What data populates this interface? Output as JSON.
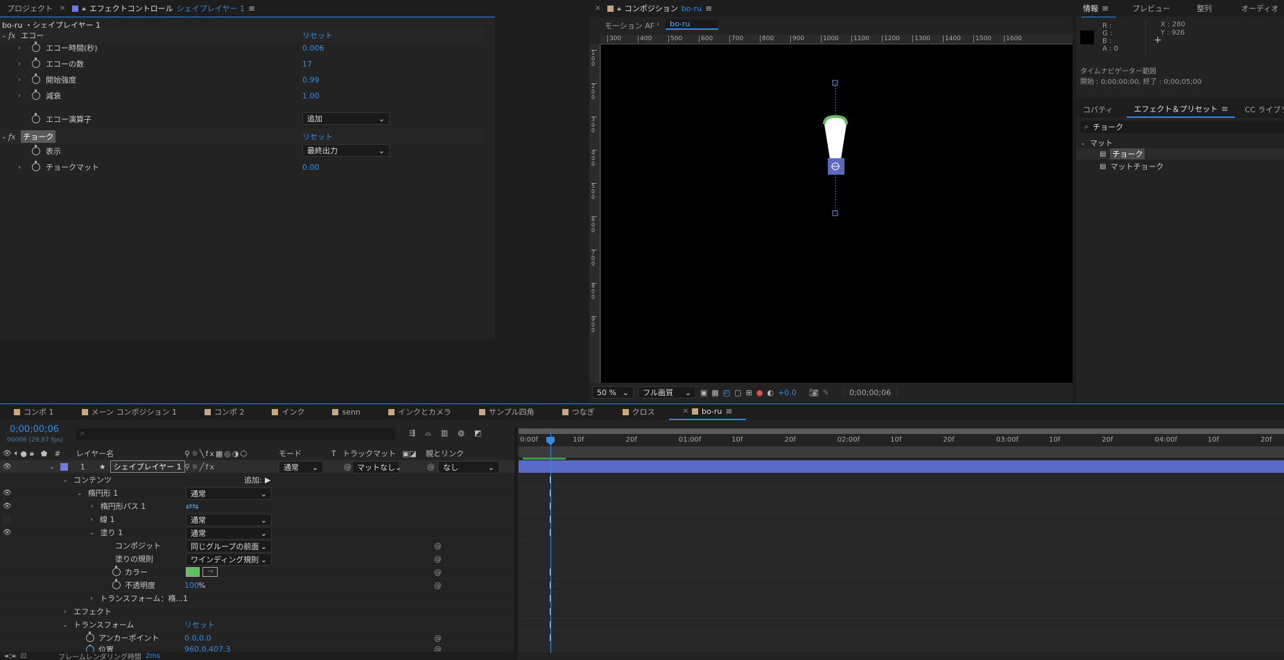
{
  "effect_panel": {
    "tab_project": "プロジェクト",
    "tab_effect_prefix": "エフェクトコントロール",
    "tab_effect_layer": "シェイプレイヤー 1",
    "breadcrumb": "bo-ru ・シェイプレイヤー 1",
    "echo": {
      "name": "エコー",
      "reset": "リセット",
      "params": [
        {
          "label": "エコー時間(秒)",
          "value": "0.006"
        },
        {
          "label": "エコーの数",
          "value": "17"
        },
        {
          "label": "開始強度",
          "value": "0.99"
        },
        {
          "label": "減衰",
          "value": "1.00"
        }
      ],
      "operator_label": "エコー演算子",
      "operator_value": "追加"
    },
    "choke": {
      "name": "チョーク",
      "reset": "リセット",
      "display_label": "表示",
      "display_value": "最終出力",
      "matte_label": "チョークマット",
      "matte_value": "0.00"
    }
  },
  "comp_panel": {
    "tab_prefix": "コンポジション",
    "tab_name": "bo-ru",
    "motion_label": "モーション AF",
    "crumb": "bo-ru",
    "ruler_h": [
      "300",
      "400",
      "500",
      "600",
      "700",
      "800",
      "900",
      "1000",
      "1100",
      "1200",
      "1300",
      "1400",
      "1500",
      "1600"
    ],
    "ruler_v": [
      "1 0 0",
      "2 0 0",
      "3 0 0",
      "4 0 0",
      "5 0 0",
      "6 0 0",
      "7 0 0",
      "8 0 0",
      "9 0 0"
    ],
    "zoom": "50 %",
    "quality": "フル画質",
    "exposure": "+0.0",
    "timecode": "0;00;00;06"
  },
  "info_panel": {
    "tabs": [
      "情報",
      "プレビュー",
      "整列",
      "オーディオ"
    ],
    "r": "R :",
    "g": "G :",
    "b": "B :",
    "a": "A : 0",
    "x": "X : 280",
    "y": "Y : 926",
    "nav_title": "タイムナビゲーター範囲",
    "nav_range": "開始 : 0;00;00;00, 終了 : 0;00;05;00"
  },
  "presets_panel": {
    "tabs": [
      "コパティ",
      "エフェクト＆プリセット",
      "CC ライブラリ"
    ],
    "search": "チョーク",
    "category": "マット",
    "items": [
      "チョーク",
      "マットチョーク"
    ]
  },
  "timeline": {
    "tabs": [
      "コンポ 1",
      "メーン コンポジション 1",
      "コンポ 2",
      "インク",
      "senn",
      "インクとカメラ",
      "サンプル四角",
      "つなぎ",
      "クロス",
      "bo-ru"
    ],
    "tab_colors": [
      "#c8a882",
      "#c8a882",
      "#c8a882",
      "#c8a882",
      "#c8a882",
      "#c8a882",
      "#c8a882",
      "#c8a882",
      "#c8a882",
      "#c8a882"
    ],
    "timecode": "0;00;00;06",
    "fps": "00006 (29.97 fps)",
    "search_placeholder": "",
    "headers": {
      "num": "#",
      "layer": "レイヤー名",
      "mode": "モード",
      "t": "T",
      "trackmatte": "トラックマット",
      "parent": "親とリンク"
    },
    "layer": {
      "num": "1",
      "name": "シェイプレイヤー 1",
      "mode": "通常",
      "matte": "マットなし",
      "parent": "なし"
    },
    "contents": "コンテンツ",
    "add": "追加:",
    "ellipse": "楕円形 1",
    "ellipse_mode": "通常",
    "ellipse_path": "楕円形パス 1",
    "stroke": "線 1",
    "stroke_mode": "通常",
    "fill": "塗り 1",
    "fill_mode": "通常",
    "composite": "コンポジット",
    "composite_value": "同じグループの前面",
    "fill_rule": "塗りの規則",
    "fill_rule_value": "ワインディング規則",
    "color": "カラー",
    "fill_color": "#5fbf5f",
    "opacity": "不透明度",
    "opacity_value": "100",
    "opacity_unit": "%",
    "transform_group": "トランスフォーム：楕...1",
    "effects": "エフェクト",
    "transform": "トランスフォーム",
    "transform_reset": "リセット",
    "anchor": "アンカーポイント",
    "anchor_value": "0.0,0.0",
    "position": "位置",
    "position_value": "960.0,407.3",
    "render_time": "フレームレンダリング時間",
    "render_ms": "2ms",
    "ruler": [
      "0:00f",
      "10f",
      "20f",
      "01:00f",
      "10f",
      "20f",
      "02:00f",
      "10f",
      "20f",
      "03:00f",
      "10f",
      "20f",
      "04:00f",
      "10f",
      "20f"
    ]
  }
}
